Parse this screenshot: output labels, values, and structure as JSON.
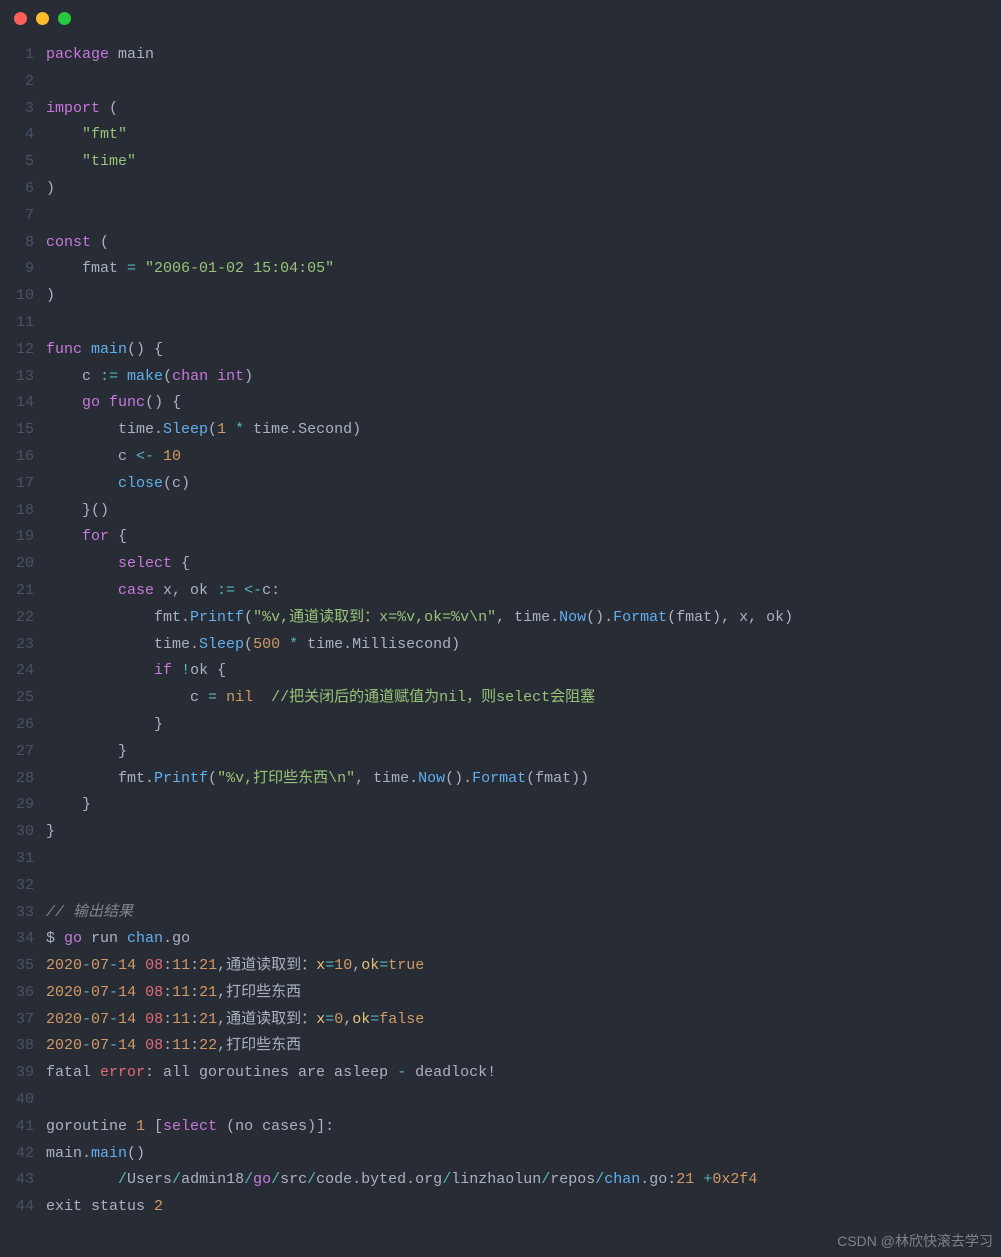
{
  "window": {
    "traffic_lights": [
      "close",
      "minimize",
      "zoom"
    ]
  },
  "watermark": "CSDN @林欣快滚去学习",
  "gutter": {
    "start": 1,
    "end": 44
  },
  "code": {
    "lines": [
      {
        "n": 1,
        "t": [
          [
            "kw",
            "package"
          ],
          [
            "id",
            " main"
          ]
        ]
      },
      {
        "n": 2,
        "t": []
      },
      {
        "n": 3,
        "t": [
          [
            "kw",
            "import"
          ],
          [
            "id",
            " ("
          ]
        ]
      },
      {
        "n": 4,
        "t": [
          [
            "id",
            "    "
          ],
          [
            "str",
            "\"fmt\""
          ]
        ]
      },
      {
        "n": 5,
        "t": [
          [
            "id",
            "    "
          ],
          [
            "str",
            "\"time\""
          ]
        ]
      },
      {
        "n": 6,
        "t": [
          [
            "id",
            ")"
          ]
        ]
      },
      {
        "n": 7,
        "t": []
      },
      {
        "n": 8,
        "t": [
          [
            "kw",
            "const"
          ],
          [
            "id",
            " ("
          ]
        ]
      },
      {
        "n": 9,
        "t": [
          [
            "id",
            "    fmat "
          ],
          [
            "op",
            "="
          ],
          [
            "id",
            " "
          ],
          [
            "str",
            "\"2006-01-02 15:04:05\""
          ]
        ]
      },
      {
        "n": 10,
        "t": [
          [
            "id",
            ")"
          ]
        ]
      },
      {
        "n": 11,
        "t": []
      },
      {
        "n": 12,
        "t": [
          [
            "kw",
            "func"
          ],
          [
            "id",
            " "
          ],
          [
            "fn",
            "main"
          ],
          [
            "id",
            "() {"
          ]
        ]
      },
      {
        "n": 13,
        "t": [
          [
            "id",
            "    c "
          ],
          [
            "op",
            ":="
          ],
          [
            "id",
            " "
          ],
          [
            "fn",
            "make"
          ],
          [
            "id",
            "("
          ],
          [
            "kw",
            "chan"
          ],
          [
            "id",
            " "
          ],
          [
            "kw",
            "int"
          ],
          [
            "id",
            ")"
          ]
        ]
      },
      {
        "n": 14,
        "t": [
          [
            "id",
            "    "
          ],
          [
            "kw",
            "go"
          ],
          [
            "id",
            " "
          ],
          [
            "kw",
            "func"
          ],
          [
            "id",
            "() {"
          ]
        ]
      },
      {
        "n": 15,
        "t": [
          [
            "id",
            "        time."
          ],
          [
            "fn",
            "Sleep"
          ],
          [
            "id",
            "("
          ],
          [
            "num",
            "1"
          ],
          [
            "id",
            " "
          ],
          [
            "op",
            "*"
          ],
          [
            "id",
            " time.Second)"
          ]
        ]
      },
      {
        "n": 16,
        "t": [
          [
            "id",
            "        c "
          ],
          [
            "op",
            "<-"
          ],
          [
            "id",
            " "
          ],
          [
            "num",
            "10"
          ]
        ]
      },
      {
        "n": 17,
        "t": [
          [
            "id",
            "        "
          ],
          [
            "fn",
            "close"
          ],
          [
            "id",
            "(c)"
          ]
        ]
      },
      {
        "n": 18,
        "t": [
          [
            "id",
            "    }()"
          ]
        ]
      },
      {
        "n": 19,
        "t": [
          [
            "id",
            "    "
          ],
          [
            "kw",
            "for"
          ],
          [
            "id",
            " {"
          ]
        ]
      },
      {
        "n": 20,
        "t": [
          [
            "id",
            "        "
          ],
          [
            "kw",
            "select"
          ],
          [
            "id",
            " {"
          ]
        ]
      },
      {
        "n": 21,
        "t": [
          [
            "id",
            "        "
          ],
          [
            "kw",
            "case"
          ],
          [
            "id",
            " x, ok "
          ],
          [
            "op",
            ":="
          ],
          [
            "id",
            " "
          ],
          [
            "op",
            "<-"
          ],
          [
            "id",
            "c:"
          ]
        ]
      },
      {
        "n": 22,
        "t": [
          [
            "id",
            "            fmt."
          ],
          [
            "fn",
            "Printf"
          ],
          [
            "id",
            "("
          ],
          [
            "str",
            "\"%v,通道读取到：x=%v,ok=%v\\n\""
          ],
          [
            "id",
            ", time."
          ],
          [
            "fn",
            "Now"
          ],
          [
            "id",
            "()."
          ],
          [
            "fn",
            "Format"
          ],
          [
            "id",
            "(fmat), x, ok)"
          ]
        ]
      },
      {
        "n": 23,
        "t": [
          [
            "id",
            "            time."
          ],
          [
            "fn",
            "Sleep"
          ],
          [
            "id",
            "("
          ],
          [
            "num",
            "500"
          ],
          [
            "id",
            " "
          ],
          [
            "op",
            "*"
          ],
          [
            "id",
            " time.Millisecond)"
          ]
        ]
      },
      {
        "n": 24,
        "t": [
          [
            "id",
            "            "
          ],
          [
            "kw",
            "if"
          ],
          [
            "id",
            " "
          ],
          [
            "op",
            "!"
          ],
          [
            "id",
            "ok {"
          ]
        ]
      },
      {
        "n": 25,
        "t": [
          [
            "id",
            "                c "
          ],
          [
            "op",
            "="
          ],
          [
            "id",
            " "
          ],
          [
            "num",
            "nil"
          ],
          [
            "id",
            "  "
          ],
          [
            "cmtg",
            "//把关闭后的通道赋值为nil，则select会阻塞"
          ]
        ]
      },
      {
        "n": 26,
        "t": [
          [
            "id",
            "            }"
          ]
        ]
      },
      {
        "n": 27,
        "t": [
          [
            "id",
            "        }"
          ]
        ]
      },
      {
        "n": 28,
        "t": [
          [
            "id",
            "        fmt."
          ],
          [
            "fn",
            "Printf"
          ],
          [
            "id",
            "("
          ],
          [
            "str",
            "\"%v,打印些东西\\n\""
          ],
          [
            "id",
            ", time."
          ],
          [
            "fn",
            "Now"
          ],
          [
            "id",
            "()."
          ],
          [
            "fn",
            "Format"
          ],
          [
            "id",
            "(fmat))"
          ]
        ]
      },
      {
        "n": 29,
        "t": [
          [
            "id",
            "    }"
          ]
        ]
      },
      {
        "n": 30,
        "t": [
          [
            "id",
            "}"
          ]
        ]
      },
      {
        "n": 31,
        "t": []
      },
      {
        "n": 32,
        "t": []
      },
      {
        "n": 33,
        "t": [
          [
            "cmt",
            "// 输出结果"
          ]
        ]
      },
      {
        "n": 34,
        "t": [
          [
            "id",
            "$ "
          ],
          [
            "kw",
            "go"
          ],
          [
            "id",
            " run "
          ],
          [
            "fn",
            "chan"
          ],
          [
            "id",
            ".go"
          ]
        ]
      },
      {
        "n": 35,
        "t": [
          [
            "or",
            "2020"
          ],
          [
            "op",
            "-"
          ],
          [
            "or",
            "07"
          ],
          [
            "op",
            "-"
          ],
          [
            "or",
            "14"
          ],
          [
            "id",
            " "
          ],
          [
            "red",
            "08"
          ],
          [
            "id",
            ":"
          ],
          [
            "or",
            "11"
          ],
          [
            "id",
            ":"
          ],
          [
            "or",
            "21"
          ],
          [
            "id",
            ",通道读取到："
          ],
          [
            "typ",
            "x"
          ],
          [
            "op",
            "="
          ],
          [
            "or",
            "10"
          ],
          [
            "id",
            ","
          ],
          [
            "typ",
            "ok"
          ],
          [
            "op",
            "="
          ],
          [
            "num",
            "true"
          ]
        ]
      },
      {
        "n": 36,
        "t": [
          [
            "or",
            "2020"
          ],
          [
            "op",
            "-"
          ],
          [
            "or",
            "07"
          ],
          [
            "op",
            "-"
          ],
          [
            "or",
            "14"
          ],
          [
            "id",
            " "
          ],
          [
            "red",
            "08"
          ],
          [
            "id",
            ":"
          ],
          [
            "or",
            "11"
          ],
          [
            "id",
            ":"
          ],
          [
            "or",
            "21"
          ],
          [
            "id",
            ",打印些东西"
          ]
        ]
      },
      {
        "n": 37,
        "t": [
          [
            "or",
            "2020"
          ],
          [
            "op",
            "-"
          ],
          [
            "or",
            "07"
          ],
          [
            "op",
            "-"
          ],
          [
            "or",
            "14"
          ],
          [
            "id",
            " "
          ],
          [
            "red",
            "08"
          ],
          [
            "id",
            ":"
          ],
          [
            "or",
            "11"
          ],
          [
            "id",
            ":"
          ],
          [
            "or",
            "21"
          ],
          [
            "id",
            ",通道读取到："
          ],
          [
            "typ",
            "x"
          ],
          [
            "op",
            "="
          ],
          [
            "or",
            "0"
          ],
          [
            "id",
            ","
          ],
          [
            "typ",
            "ok"
          ],
          [
            "op",
            "="
          ],
          [
            "num",
            "false"
          ]
        ]
      },
      {
        "n": 38,
        "t": [
          [
            "or",
            "2020"
          ],
          [
            "op",
            "-"
          ],
          [
            "or",
            "07"
          ],
          [
            "op",
            "-"
          ],
          [
            "or",
            "14"
          ],
          [
            "id",
            " "
          ],
          [
            "red",
            "08"
          ],
          [
            "id",
            ":"
          ],
          [
            "or",
            "11"
          ],
          [
            "id",
            ":"
          ],
          [
            "or",
            "22"
          ],
          [
            "id",
            ",打印些东西"
          ]
        ]
      },
      {
        "n": 39,
        "t": [
          [
            "id",
            "fatal "
          ],
          [
            "red",
            "error"
          ],
          [
            "id",
            ": all goroutines are asleep "
          ],
          [
            "op",
            "-"
          ],
          [
            "id",
            " deadlock!"
          ]
        ]
      },
      {
        "n": 40,
        "t": []
      },
      {
        "n": 41,
        "t": [
          [
            "id",
            "goroutine "
          ],
          [
            "or",
            "1"
          ],
          [
            "id",
            " ["
          ],
          [
            "kw",
            "select"
          ],
          [
            "id",
            " (no cases)]:"
          ]
        ]
      },
      {
        "n": 42,
        "t": [
          [
            "id",
            "main."
          ],
          [
            "fn",
            "main"
          ],
          [
            "id",
            "()"
          ]
        ]
      },
      {
        "n": 43,
        "t": [
          [
            "id",
            "        "
          ],
          [
            "op",
            "/"
          ],
          [
            "id",
            "Users"
          ],
          [
            "op",
            "/"
          ],
          [
            "id",
            "admin18"
          ],
          [
            "op",
            "/"
          ],
          [
            "kw",
            "go"
          ],
          [
            "op",
            "/"
          ],
          [
            "id",
            "src"
          ],
          [
            "op",
            "/"
          ],
          [
            "id",
            "code.byted.org"
          ],
          [
            "op",
            "/"
          ],
          [
            "id",
            "linzhaolun"
          ],
          [
            "op",
            "/"
          ],
          [
            "id",
            "repos"
          ],
          [
            "op",
            "/"
          ],
          [
            "fn",
            "chan"
          ],
          [
            "id",
            ".go:"
          ],
          [
            "or",
            "21"
          ],
          [
            "id",
            " "
          ],
          [
            "op",
            "+"
          ],
          [
            "or",
            "0x2f4"
          ]
        ]
      },
      {
        "n": 44,
        "t": [
          [
            "id",
            "exit status "
          ],
          [
            "or",
            "2"
          ]
        ]
      }
    ]
  }
}
